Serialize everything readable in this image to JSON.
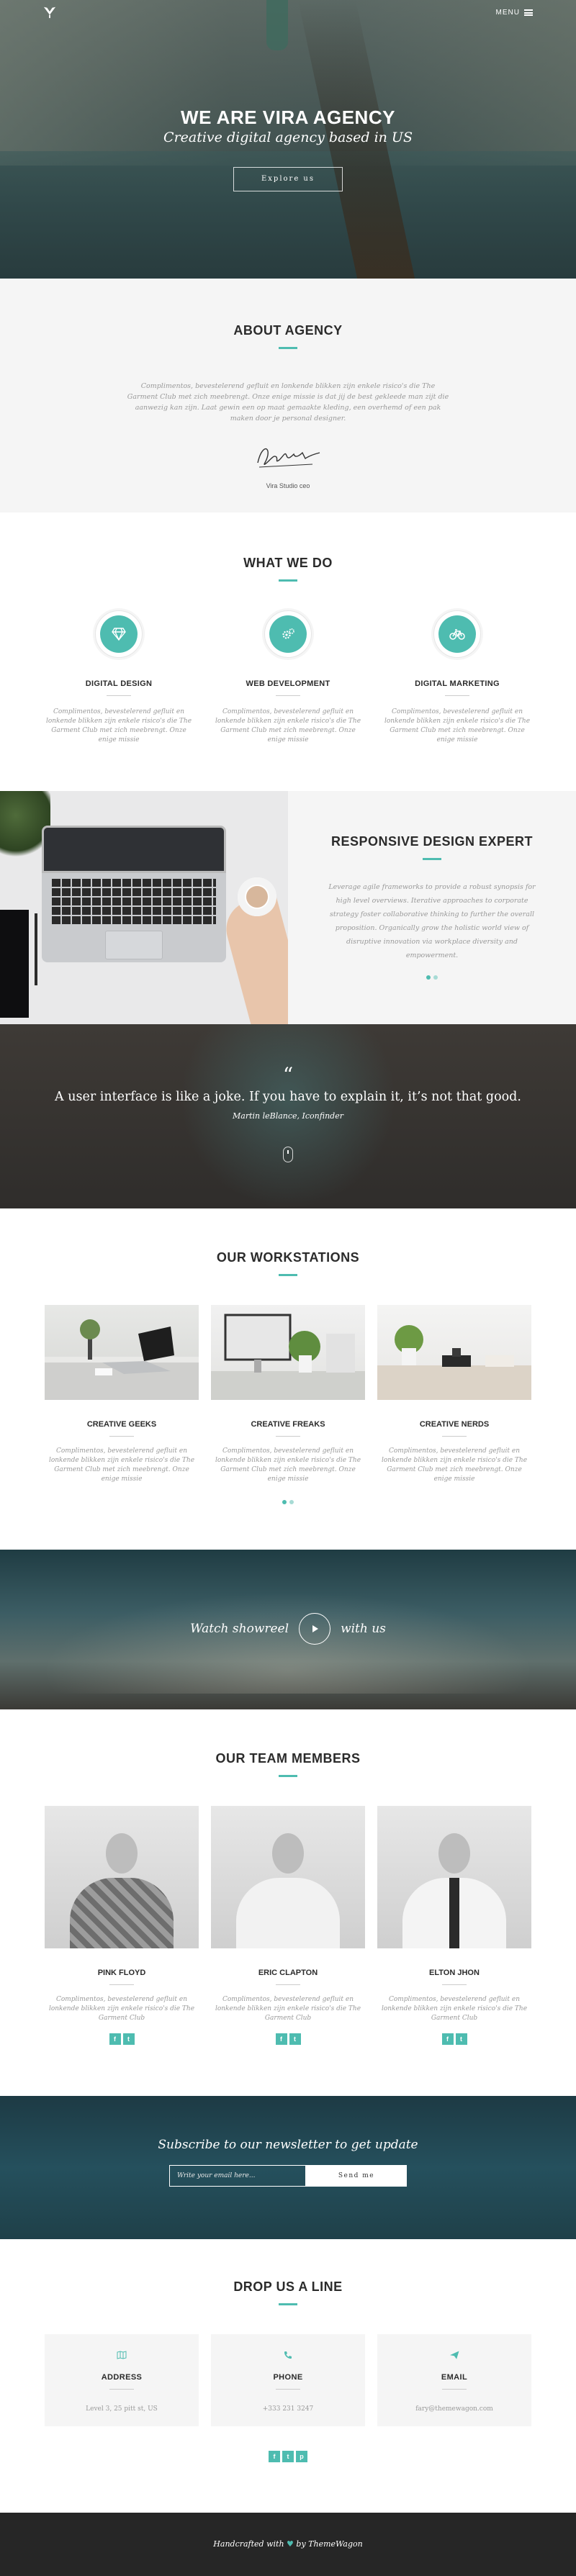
{
  "hero": {
    "menu_label": "MENU",
    "title": "WE ARE VIRA AGENCY",
    "subtitle": "Creative digital agency based in US",
    "button": "Explore us"
  },
  "about": {
    "title": "ABOUT AGENCY",
    "text": "Complimentos, bevestelerend gefluit en lonkende blikken zijn enkele risico's die The Garment Club met zich meebrengt. Onze enige missie is dat jij de best gekleede man zijt die aanwezig kan zijn. Laat gewin een op maat gemaakte kleding, een overhemd of een pak maken door je personal designer.",
    "signature_name": "Vira Studio ceo"
  },
  "whatwedo": {
    "title": "WHAT WE DO",
    "items": [
      {
        "icon": "diamond-icon",
        "title": "DIGITAL DESIGN",
        "text": "Complimentos, bevestelerend gefluit en lonkende blikken zijn enkele risico's die The Garment Club met zich meebrengt. Onze enige missie"
      },
      {
        "icon": "gears-icon",
        "title": "WEB DEVELOPMENT",
        "text": "Complimentos, bevestelerend gefluit en lonkende blikken zijn enkele risico's die The Garment Club met zich meebrengt. Onze enige missie"
      },
      {
        "icon": "bicycle-icon",
        "title": "DIGITAL MARKETING",
        "text": "Complimentos, bevestelerend gefluit en lonkende blikken zijn enkele risico's die The Garment Club met zich meebrengt. Onze enige missie"
      }
    ]
  },
  "responsive": {
    "title": "RESPONSIVE DESIGN EXPERT",
    "text": "Leverage agile frameworks to provide a robust synopsis for high level overviews. Iterative approaches to corporate strategy foster collaborative thinking to further the overall proposition. Organically grow the holistic world view of disruptive innovation via workplace diversity and empowerment."
  },
  "quote": {
    "mark": "“",
    "text": "A user interface is like a joke. If you have to explain it, it’s not that good.",
    "author": "Martin leBlance, Iconfinder"
  },
  "workstations": {
    "title": "OUR WORKSTATIONS",
    "items": [
      {
        "title": "CREATIVE GEEKS",
        "text": "Complimentos, bevestelerend gefluit en lonkende blikken zijn enkele risico's die The Garment Club met zich meebrengt. Onze enige missie"
      },
      {
        "title": "CREATIVE FREAKS",
        "text": "Complimentos, bevestelerend gefluit en lonkende blikken zijn enkele risico's die The Garment Club met zich meebrengt. Onze enige missie"
      },
      {
        "title": "CREATIVE NERDS",
        "text": "Complimentos, bevestelerend gefluit en lonkende blikken zijn enkele risico's die The Garment Club met zich meebrengt. Onze enige missie"
      }
    ]
  },
  "showreel": {
    "left": "Watch showreel",
    "right": "with us"
  },
  "team": {
    "title": "OUR TEAM MEMBERS",
    "members": [
      {
        "name": "PINK FLOYD",
        "text": "Complimentos, bevestelerend gefluit en lonkende blikken zijn enkele risico's die The Garment Club"
      },
      {
        "name": "ERIC CLAPTON",
        "text": "Complimentos, bevestelerend gefluit en lonkende blikken zijn enkele risico's die The Garment Club"
      },
      {
        "name": "ELTON JHON",
        "text": "Complimentos, bevestelerend gefluit en lonkende blikken zijn enkele risico's die The Garment Club"
      }
    ],
    "social": {
      "facebook": "f",
      "twitter": "t"
    }
  },
  "newsletter": {
    "title": "Subscribe to our newsletter to get update",
    "placeholder": "Write your email here...",
    "button": "Send me"
  },
  "contact": {
    "title": "DROP US A LINE",
    "cards": [
      {
        "icon": "map-icon",
        "title": "ADDRESS",
        "value": "Level 3, 25 pitt st, US"
      },
      {
        "icon": "phone-icon",
        "title": "PHONE",
        "value": "+333 231 3247"
      },
      {
        "icon": "paper-plane-icon",
        "title": "EMAIL",
        "value": "fary@themewagon.com"
      }
    ],
    "social": {
      "facebook": "f",
      "twitter": "t",
      "pinterest": "p"
    }
  },
  "footer": {
    "prefix": "Handcrafted with",
    "suffix": "by ThemeWagon"
  },
  "colors": {
    "accent": "#4ebcb0",
    "dark": "#262626",
    "light_bg": "#f5f5f5"
  }
}
